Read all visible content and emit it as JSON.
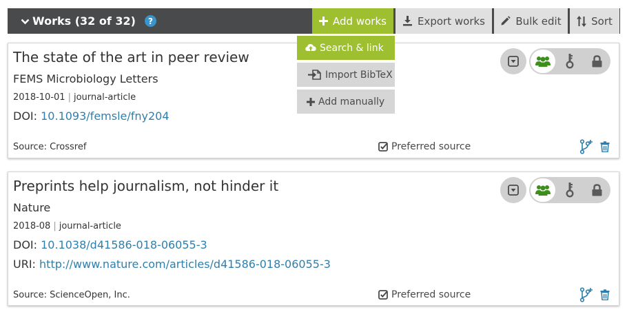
{
  "header": {
    "title": "Works (32 of 32)",
    "help_glyph": "?",
    "buttons": {
      "add_works": "Add works",
      "export_works": "Export works",
      "bulk_edit": "Bulk edit",
      "sort": "Sort"
    }
  },
  "add_menu": {
    "items": [
      {
        "label": "Search & link",
        "icon": "cloud-upload-icon",
        "active": true
      },
      {
        "label": "Import BibTeX",
        "icon": "file-import-icon",
        "active": false
      },
      {
        "label": "Add manually",
        "icon": "plus-icon",
        "active": false
      }
    ]
  },
  "works": [
    {
      "title": "The state of the art in peer review",
      "journal": "FEMS Microbiology Letters",
      "date": "2018-10-01",
      "type": "journal-article",
      "doi_label": "DOI:",
      "doi": "10.1093/femsle/fny204",
      "source": "Source: Crossref",
      "preferred": "Preferred source"
    },
    {
      "title": "Preprints help journalism, not hinder it",
      "journal": "Nature",
      "date": "2018-08",
      "type": "journal-article",
      "doi_label": "DOI:",
      "doi": "10.1038/d41586-018-06055-3",
      "uri_label": "URI:",
      "uri": "http://www.nature.com/articles/d41586-018-06055-3",
      "source": "Source: ScienceOpen, Inc.",
      "preferred": "Preferred source"
    }
  ],
  "colors": {
    "header_bg": "#494a4c",
    "accent_green": "#9ebf2f",
    "link_blue": "#2e7fad",
    "visibility_everyone": "#3d8f1c"
  }
}
